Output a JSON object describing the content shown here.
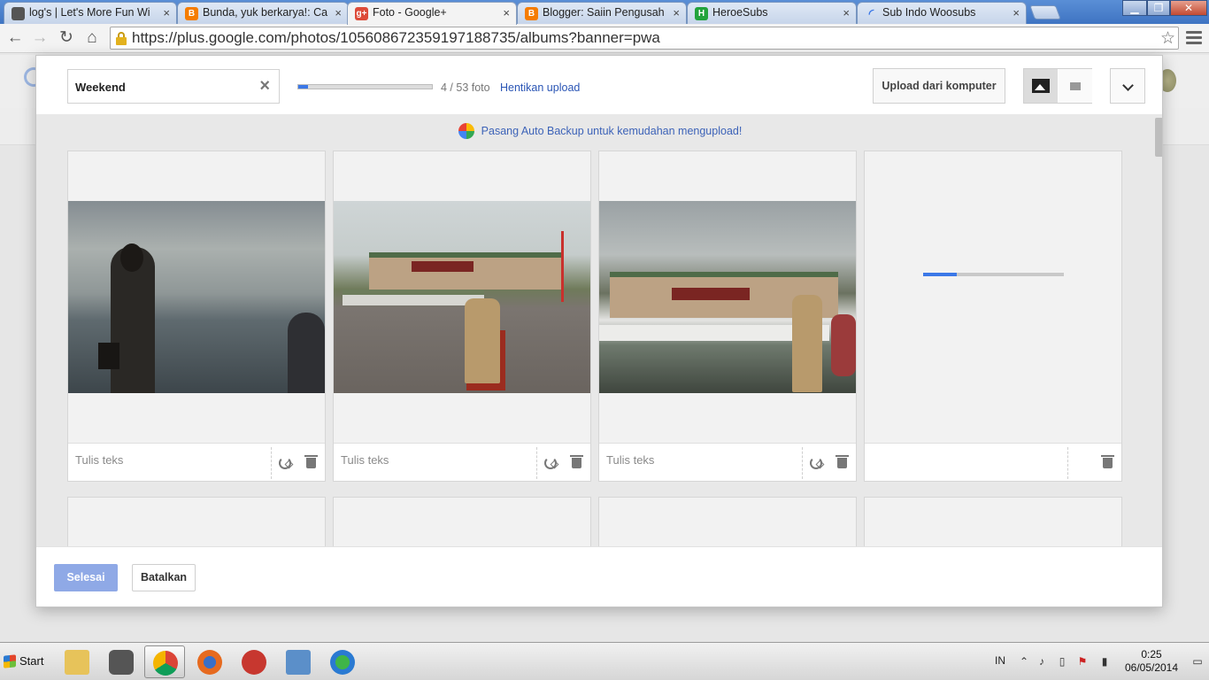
{
  "browser": {
    "tabs": [
      {
        "title": "log's | Let's More Fun Wi",
        "favicon_color": "#555555",
        "active": false
      },
      {
        "title": "Bunda, yuk berkarya!: Ca",
        "favicon_color": "#f57c00",
        "active": false
      },
      {
        "title": "Foto - Google+",
        "favicon_color": "#dd4b39",
        "active": true
      },
      {
        "title": "Blogger: Saiin Pengusah",
        "favicon_color": "#f57c00",
        "active": false
      },
      {
        "title": "HeroeSubs",
        "favicon_color": "#22a33c",
        "active": false
      },
      {
        "title": "Sub Indo Woosubs",
        "favicon_color": "#3b78e7",
        "active": false
      }
    ],
    "url": "https://plus.google.com/photos/105608672359197188735/albums?banner=pwa"
  },
  "dialog": {
    "album_name_value": "Weekend",
    "upload_progress_fraction": 0.0755,
    "upload_count": "4 / 53 foto",
    "stop_upload_link": "Hentikan upload",
    "upload_from_computer": "Upload dari komputer",
    "auto_backup_banner": "Pasang Auto Backup untuk kemudahan mengupload!",
    "photos": [
      {
        "caption_placeholder": "Tulis teks",
        "uploaded": true
      },
      {
        "caption_placeholder": "Tulis teks",
        "uploaded": true
      },
      {
        "caption_placeholder": "Tulis teks",
        "uploaded": true
      },
      {
        "caption_placeholder": "",
        "uploaded": false,
        "progress_fraction": 0.24
      }
    ],
    "done_button": "Selesai",
    "cancel_button": "Batalkan"
  },
  "taskbar": {
    "start_label": "Start",
    "language": "IN",
    "time": "0:25",
    "date": "06/05/2014"
  },
  "colors": {
    "accent_blue": "#3b78e7",
    "link_blue": "#2a55b5",
    "done_button_bg": "#8fa9e6"
  }
}
